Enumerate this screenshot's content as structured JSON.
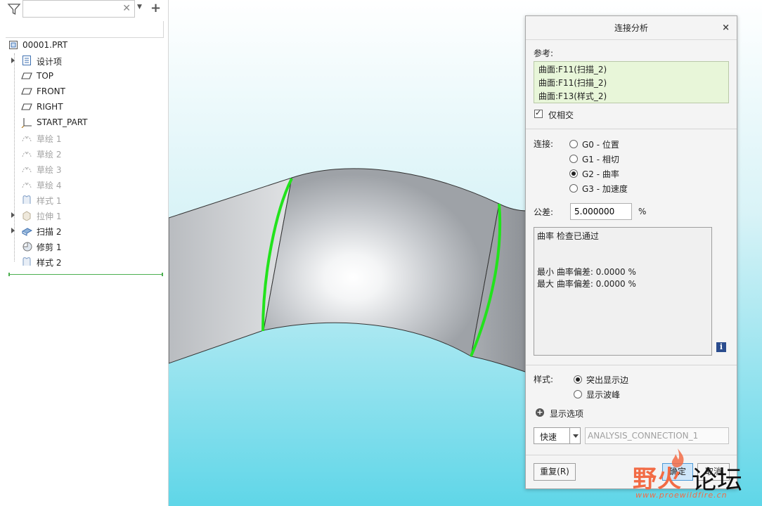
{
  "tree": {
    "search_value": "",
    "root_label": "00001.PRT",
    "items": [
      {
        "label": "设计项",
        "icon": "layers-icon",
        "expandable": true,
        "dim": false
      },
      {
        "label": "TOP",
        "icon": "datum-plane-icon",
        "expandable": false,
        "dim": false
      },
      {
        "label": "FRONT",
        "icon": "datum-plane-icon",
        "expandable": false,
        "dim": false
      },
      {
        "label": "RIGHT",
        "icon": "datum-plane-icon",
        "expandable": false,
        "dim": false
      },
      {
        "label": "START_PART",
        "icon": "coordinate-system-icon",
        "expandable": false,
        "dim": false
      },
      {
        "label": "草绘 1",
        "icon": "sketch-icon",
        "expandable": false,
        "dim": true
      },
      {
        "label": "草绘 2",
        "icon": "sketch-icon",
        "expandable": false,
        "dim": true
      },
      {
        "label": "草绘 3",
        "icon": "sketch-icon",
        "expandable": false,
        "dim": true
      },
      {
        "label": "草绘 4",
        "icon": "sketch-icon",
        "expandable": false,
        "dim": true
      },
      {
        "label": "样式 1",
        "icon": "style-icon",
        "expandable": false,
        "dim": true
      },
      {
        "label": "拉伸 1",
        "icon": "extrude-icon",
        "expandable": true,
        "dim": true
      },
      {
        "label": "扫描 2",
        "icon": "sweep-icon",
        "expandable": true,
        "dim": false
      },
      {
        "label": "修剪 1",
        "icon": "trim-icon",
        "expandable": false,
        "dim": false
      },
      {
        "label": "样式 2",
        "icon": "style-icon",
        "expandable": false,
        "dim": false
      }
    ]
  },
  "dialog": {
    "title": "连接分析",
    "close_icon": "×",
    "reference_label": "参考:",
    "references": [
      "曲面:F11(扫描_2)",
      "曲面:F11(扫描_2)",
      "曲面:F13(样式_2)"
    ],
    "only_intersect_label": "仅相交",
    "only_intersect_checked": true,
    "connection_label": "连接:",
    "connection_options": [
      {
        "label": "G0 - 位置",
        "selected": false
      },
      {
        "label": "G1 - 相切",
        "selected": false
      },
      {
        "label": "G2 - 曲率",
        "selected": true
      },
      {
        "label": "G3 - 加速度",
        "selected": false
      }
    ],
    "tolerance_label": "公差:",
    "tolerance_value": "5.000000",
    "tolerance_unit": "%",
    "results": [
      "曲率 检查已通过",
      "",
      "",
      "最小 曲率偏差: 0.0000 %",
      "最大 曲率偏差: 0.0000 %"
    ],
    "info_icon": "i",
    "style_label": "样式:",
    "style_options": [
      {
        "label": "突出显示边",
        "selected": true
      },
      {
        "label": "显示波峰",
        "selected": false
      }
    ],
    "display_options_label": "显示选项",
    "speed_value": "快速",
    "analysis_name": "ANALYSIS_CONNECTION_1",
    "repeat_label": "重复(R)",
    "ok_label": "确定",
    "cancel_label": "取消"
  },
  "watermark": {
    "text_a": "野火",
    "text_b": "论坛",
    "url": "www.proewildfire.cn"
  },
  "colors": {
    "viewport_top": "#ffffff",
    "viewport_bottom": "#5fd6e8",
    "highlight_edge": "#22e31c",
    "reference_bg": "#e8f6d9",
    "watermark_accent": "#f26b45"
  }
}
